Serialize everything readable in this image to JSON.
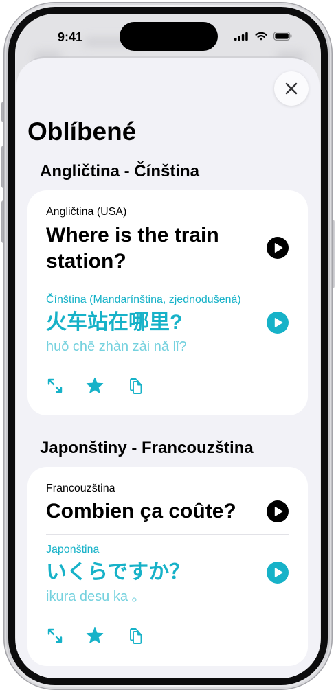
{
  "status_bar": {
    "time": "9:41",
    "icons": [
      "signal-icon",
      "wifi-icon",
      "battery-icon"
    ]
  },
  "sheet": {
    "title": "Oblíbené",
    "close_icon": "xmark-icon"
  },
  "favorites": [
    {
      "section_title": "Angličtina - Čínština",
      "source": {
        "language": "Angličtina (USA)",
        "text": "Where is the train station?",
        "play_icon": "play-fill-icon"
      },
      "target": {
        "language": "Čínština (Mandarínština, zjednodušená)",
        "text": "火车站在哪里?",
        "romanization": "huǒ chē zhàn zài nǎ lǐ?",
        "play_icon": "play-fill-icon"
      },
      "actions": [
        "expand-icon",
        "star-fill-icon",
        "copy-icon"
      ]
    },
    {
      "section_title": "Japonštiny - Francouzština",
      "source": {
        "language": "Francouzština",
        "text": "Combien ça coûte?",
        "play_icon": "play-fill-icon"
      },
      "target": {
        "language": "Japonština",
        "text": "いくらですか？",
        "romanization": "ikura desu ka 。",
        "play_icon": "play-fill-icon"
      },
      "actions": [
        "expand-icon",
        "star-fill-icon",
        "copy-icon"
      ]
    }
  ],
  "colors": {
    "accent": "#17b2c8",
    "accent_secondary": "#74d1de",
    "sheet_background": "#f2f2f7",
    "card_background": "#ffffff",
    "primary_text": "#000000",
    "source_play_button": "#000000"
  }
}
